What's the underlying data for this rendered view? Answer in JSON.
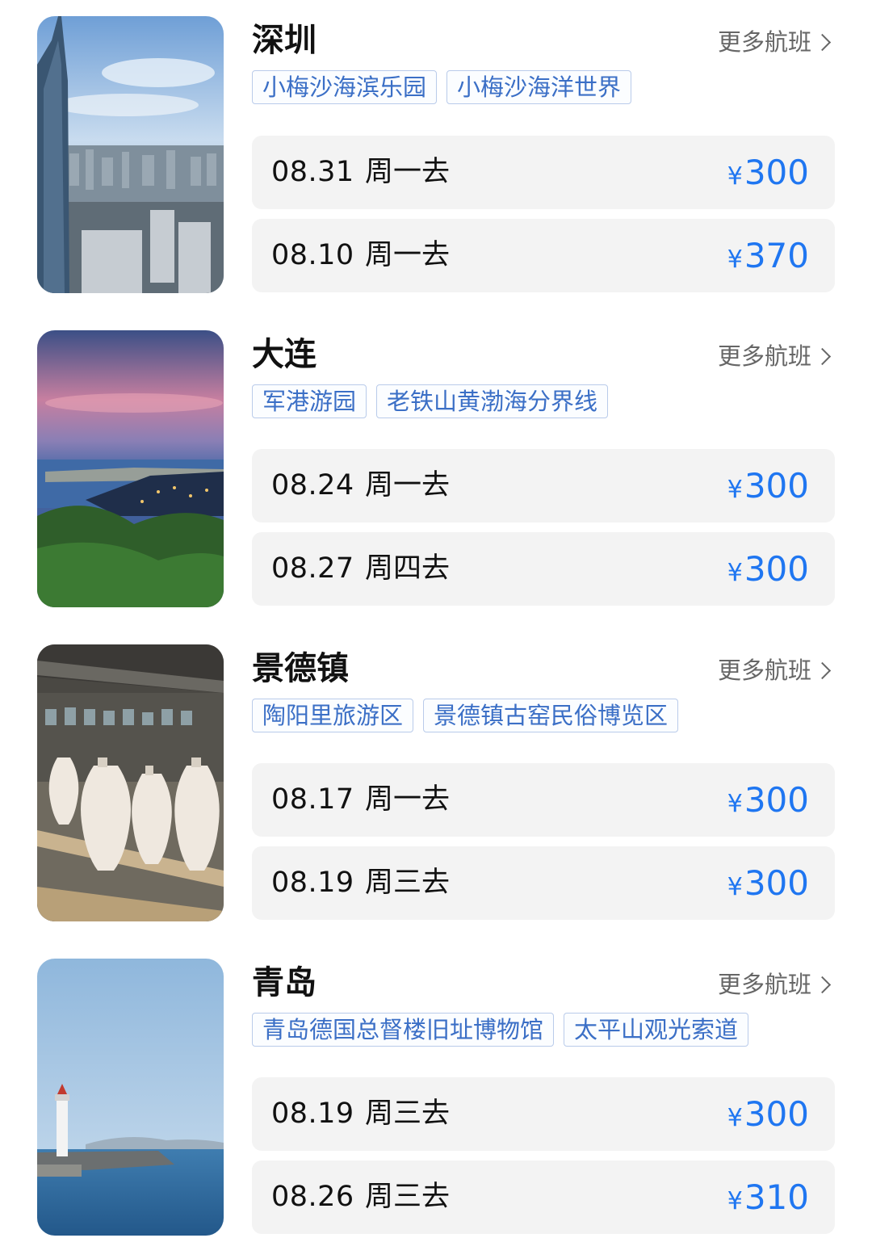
{
  "more_label": "更多航班",
  "currency_symbol": "¥",
  "destinations": [
    {
      "city": "深圳",
      "tags": [
        "小梅沙海滨乐园",
        "小梅沙海洋世界"
      ],
      "flights": [
        {
          "date": "08.31",
          "day": "周一去",
          "price": "300"
        },
        {
          "date": "08.10",
          "day": "周一去",
          "price": "370"
        }
      ]
    },
    {
      "city": "大连",
      "tags": [
        "军港游园",
        "老铁山黄渤海分界线"
      ],
      "flights": [
        {
          "date": "08.24",
          "day": "周一去",
          "price": "300"
        },
        {
          "date": "08.27",
          "day": "周四去",
          "price": "300"
        }
      ]
    },
    {
      "city": "景德镇",
      "tags": [
        "陶阳里旅游区",
        "景德镇古窑民俗博览区"
      ],
      "flights": [
        {
          "date": "08.17",
          "day": "周一去",
          "price": "300"
        },
        {
          "date": "08.19",
          "day": "周三去",
          "price": "300"
        }
      ]
    },
    {
      "city": "青岛",
      "tags": [
        "青岛德国总督楼旧址博物馆",
        "太平山观光索道"
      ],
      "flights": [
        {
          "date": "08.19",
          "day": "周三去",
          "price": "300"
        },
        {
          "date": "08.26",
          "day": "周三去",
          "price": "310"
        }
      ]
    }
  ],
  "colors": {
    "price": "#1f76f1",
    "tag_text": "#3b6fc6",
    "tag_border": "#b9cbea",
    "flight_bg": "#f3f3f3"
  }
}
